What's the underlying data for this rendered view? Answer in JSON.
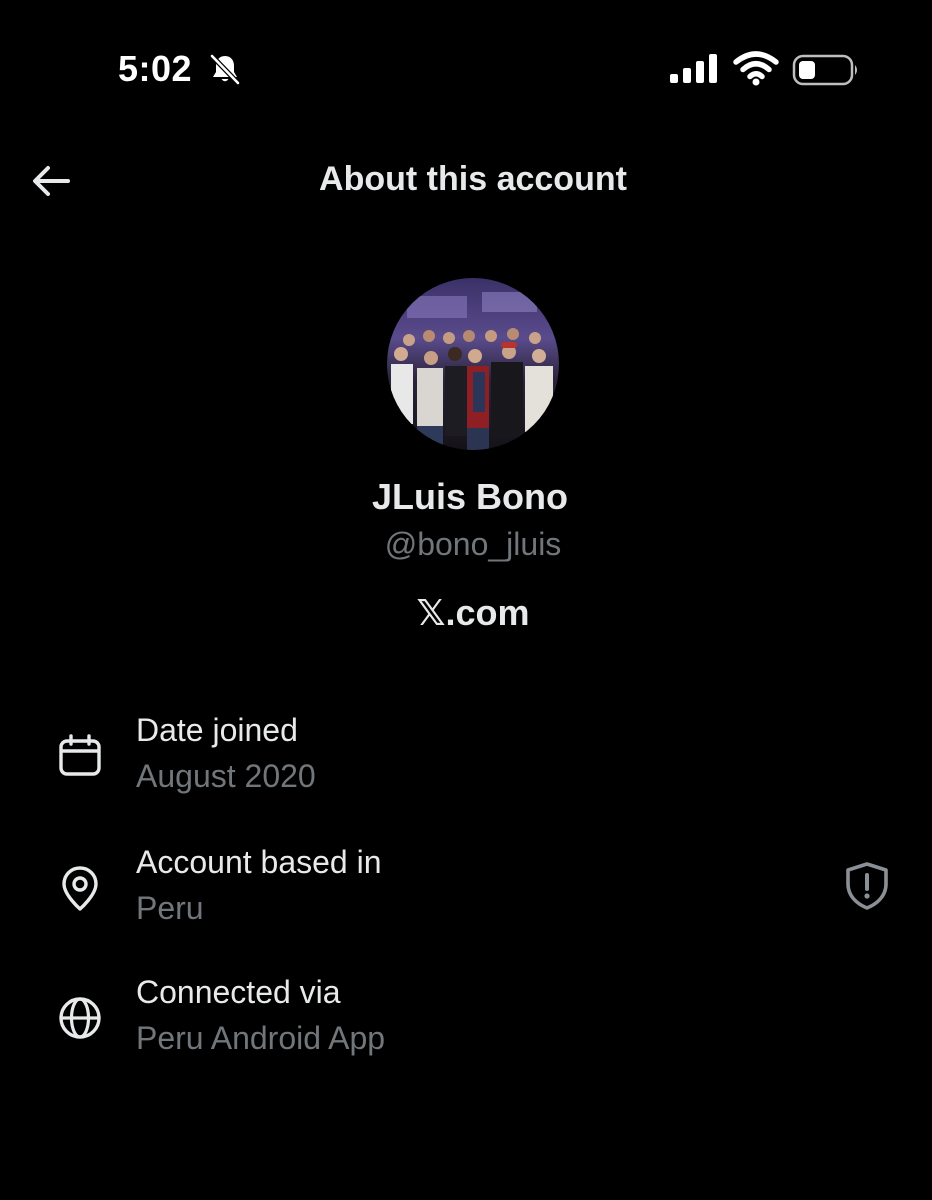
{
  "status_bar": {
    "time": "5:02",
    "icons": [
      "bell-slash-icon",
      "cellular-signal-icon",
      "wifi-icon",
      "battery-icon"
    ]
  },
  "header": {
    "title": "About this account",
    "back_icon": "arrow-left-icon"
  },
  "profile": {
    "name": "JLuis Bono",
    "handle": "@bono_jluis",
    "site": "𝕏.com"
  },
  "info": {
    "date_joined": {
      "title": "Date joined",
      "value": "August 2020",
      "icon": "calendar-icon"
    },
    "based_in": {
      "title": "Account based in",
      "value": "Peru",
      "icon": "location-pin-icon",
      "action_icon": "shield-alert-icon"
    },
    "connected_via": {
      "title": "Connected via",
      "value": "Peru Android App",
      "icon": "globe-icon"
    }
  },
  "colors": {
    "background": "#000000",
    "primary_text": "#e7e9ea",
    "secondary_text": "#71767b"
  }
}
